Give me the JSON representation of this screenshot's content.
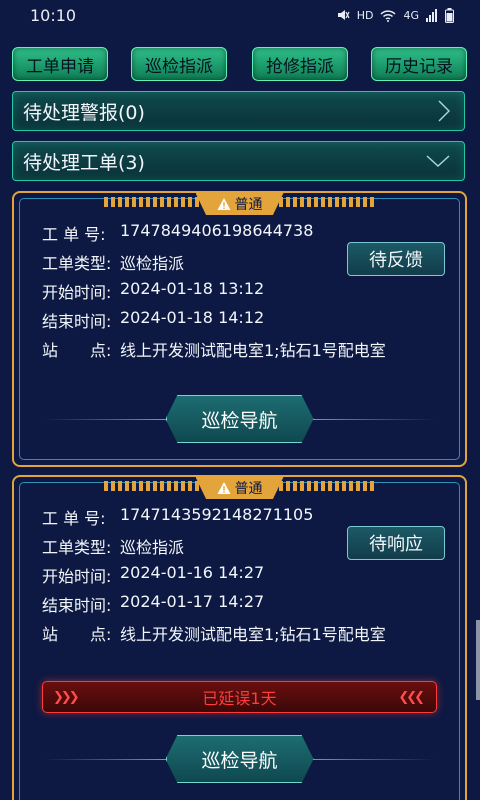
{
  "status_bar": {
    "time": "10:10",
    "network": "4G",
    "hd": "HD"
  },
  "tabs": [
    {
      "label": "工单申请"
    },
    {
      "label": "巡检指派"
    },
    {
      "label": "抢修指派"
    },
    {
      "label": "历史记录"
    }
  ],
  "sections": {
    "alarms": {
      "label": "待处理警报(0)"
    },
    "orders": {
      "label": "待处理工单(3)"
    }
  },
  "labels": {
    "order_no": "工 单 号:",
    "order_type": "工单类型:",
    "start_time": "开始时间:",
    "end_time": "结束时间:",
    "station": "站　　点:"
  },
  "cards": [
    {
      "priority": "普通",
      "order_no": "1747849406198644738",
      "order_type": "巡检指派",
      "start_time": "2024-01-18 13:12",
      "end_time": "2024-01-18 14:12",
      "station": "线上开发测试配电室1;钻石1号配电室",
      "status": "待反馈",
      "nav_label": "巡检导航"
    },
    {
      "priority": "普通",
      "order_no": "1747143592148271105",
      "order_type": "巡检指派",
      "start_time": "2024-01-16 14:27",
      "end_time": "2024-01-17 14:27",
      "station": "线上开发测试配电室1;钻石1号配电室",
      "status": "待响应",
      "delay": "已延误1天",
      "nav_label": "巡检导航"
    }
  ],
  "colors": {
    "background": "#0d1942",
    "accent_green": "#2fc08a",
    "card_border": "#e2a43b",
    "delay_red": "#ff3b3b"
  }
}
